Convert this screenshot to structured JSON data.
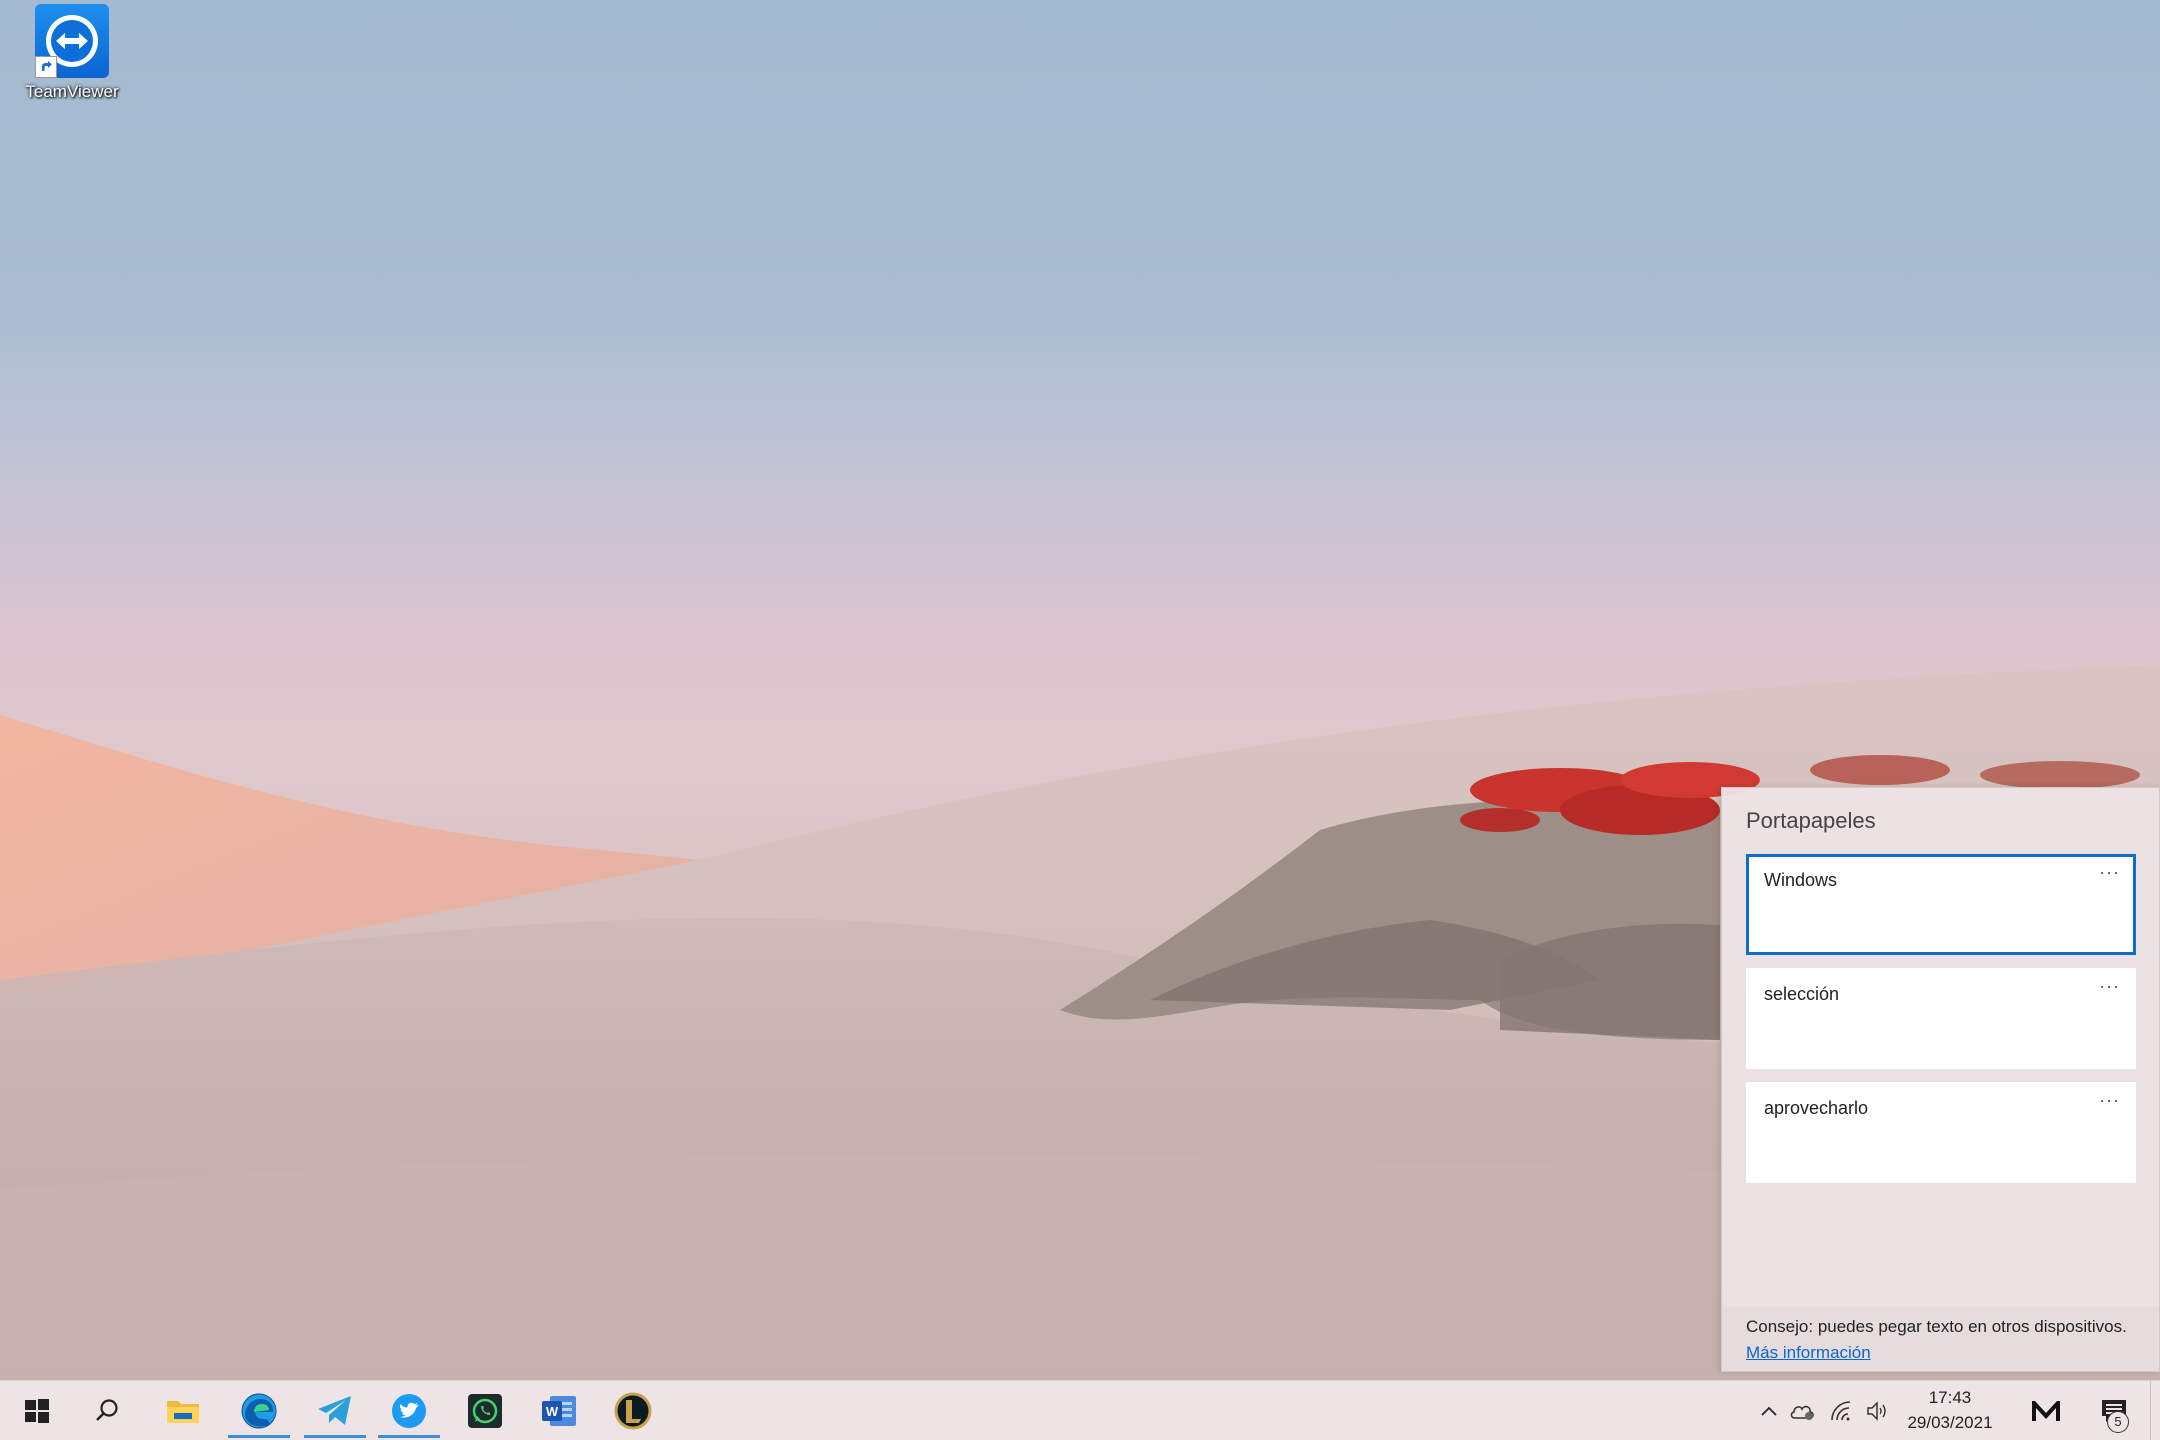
{
  "desktop": {
    "icons": [
      {
        "label": "TeamViewer",
        "icon": "teamviewer-icon"
      }
    ]
  },
  "clipboard": {
    "title": "Portapapeles",
    "items": [
      {
        "text": "Windows",
        "more": "···",
        "selected": true
      },
      {
        "text": "selección",
        "more": "···",
        "selected": false
      },
      {
        "text": "aprovecharlo",
        "more": "···",
        "selected": false
      }
    ],
    "tip_text": "Consejo: puedes pegar texto en otros dispositivos.",
    "tip_link": "Más información"
  },
  "taskbar": {
    "apps": [
      {
        "icon": "windows-start-icon"
      },
      {
        "icon": "search-icon"
      },
      {
        "icon": "file-explorer-icon"
      },
      {
        "icon": "edge-icon",
        "active": true
      },
      {
        "icon": "telegram-icon",
        "active": true
      },
      {
        "icon": "twitter-icon",
        "active": true
      },
      {
        "icon": "whatsapp-icon"
      },
      {
        "icon": "word-icon"
      },
      {
        "icon": "league-of-legends-icon"
      }
    ],
    "tray": {
      "icons": [
        "chevron-up-icon",
        "cloud-icon",
        "wifi-icon",
        "volume-icon",
        "app-m-icon",
        "notifications-icon"
      ],
      "time": "17:43",
      "date": "29/03/2021",
      "notification_count": "5"
    }
  },
  "colors": {
    "accent": "#0a6fd0",
    "taskbar_bg": "#efe4e5",
    "panel_bg": "#ece2e4",
    "link": "#0a66c8"
  }
}
